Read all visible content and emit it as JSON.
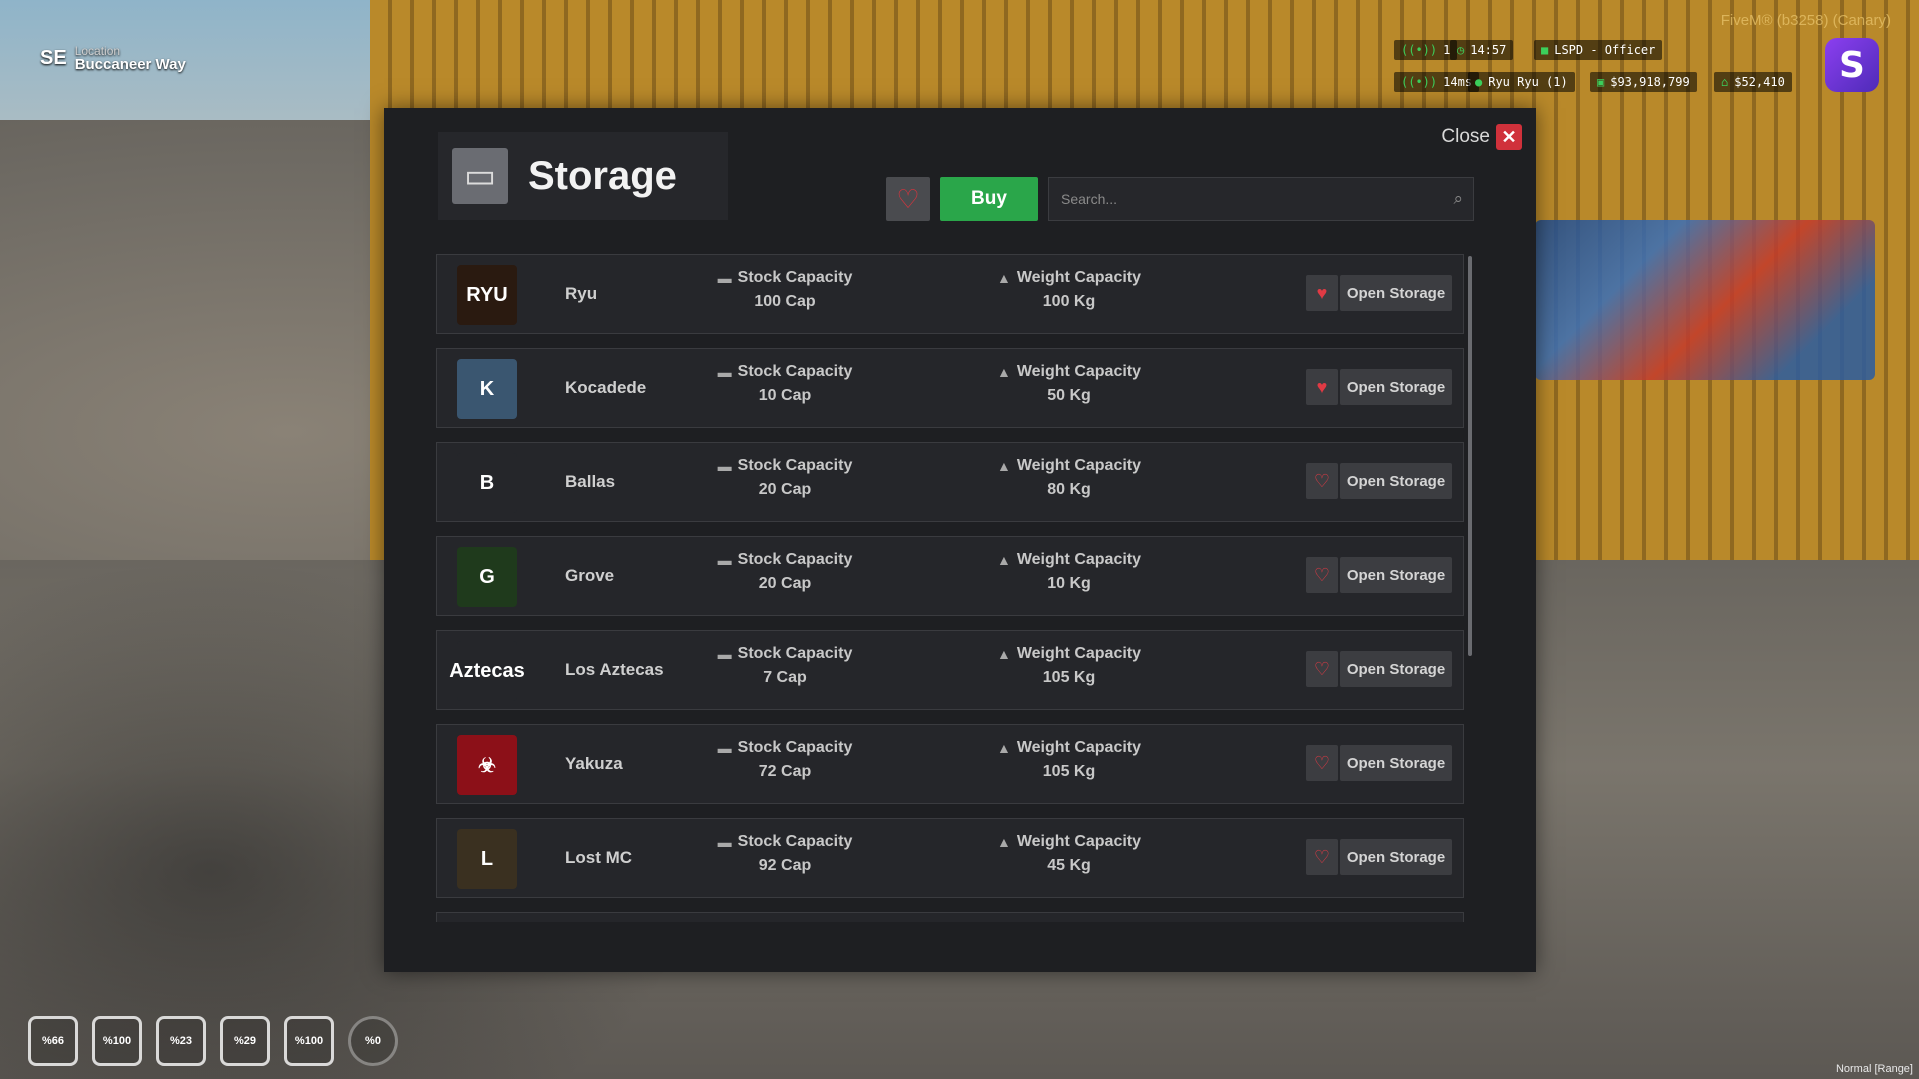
{
  "location": {
    "direction": "SE",
    "label": "Location",
    "street": "Buccaneer Way"
  },
  "client": {
    "version_label": "FiveM® (b3258) (Canary)"
  },
  "hud": {
    "players": "1",
    "time": "14:57",
    "job": "LSPD - Officer",
    "ping": "14ms",
    "player_name": "Ryu Ryu (1)",
    "cash": "$93,918,799",
    "bank": "$52,410"
  },
  "storage": {
    "title": "Storage",
    "close_label": "Close",
    "buy_label": "Buy",
    "search_placeholder": "Search...",
    "stock_label": "Stock Capacity",
    "weight_label": "Weight Capacity",
    "open_label": "Open Storage",
    "items": [
      {
        "name": "Ryu",
        "logo_text": "RYU",
        "logo_color": "#2a1a10",
        "stock": "100 Cap",
        "weight": "100 Kg",
        "favorite": true
      },
      {
        "name": "Kocadede",
        "logo_text": "K",
        "logo_color": "#3a5670",
        "stock": "10 Cap",
        "weight": "50 Kg",
        "favorite": true
      },
      {
        "name": "Ballas",
        "logo_text": "B",
        "logo_color": "#25262a",
        "stock": "20 Cap",
        "weight": "80 Kg",
        "favorite": false
      },
      {
        "name": "Grove",
        "logo_text": "G",
        "logo_color": "#1f3a1c",
        "stock": "20 Cap",
        "weight": "10 Kg",
        "favorite": false
      },
      {
        "name": "Los Aztecas",
        "logo_text": "Aztecas",
        "logo_color": "#25262a",
        "stock": "7 Cap",
        "weight": "105 Kg",
        "favorite": false
      },
      {
        "name": "Yakuza",
        "logo_text": "☣",
        "logo_color": "#8c1018",
        "stock": "72 Cap",
        "weight": "105 Kg",
        "favorite": false
      },
      {
        "name": "Lost MC",
        "logo_text": "L",
        "logo_color": "#3a3020",
        "stock": "92 Cap",
        "weight": "45 Kg",
        "favorite": false
      }
    ]
  },
  "status_bar": [
    {
      "value": "%66",
      "icon": "microphone-icon"
    },
    {
      "value": "%100",
      "icon": "heart-icon"
    },
    {
      "value": "%23",
      "icon": "food-icon"
    },
    {
      "value": "%29",
      "icon": "water-icon"
    },
    {
      "value": "%100",
      "icon": "stamina-icon"
    },
    {
      "value": "%0",
      "icon": "armor-icon"
    }
  ],
  "voice_mode": "Normal [Range]",
  "colors": {
    "accent_green": "#2aa64a",
    "close_red": "#d0313b",
    "fav_red": "#e03a44",
    "panel_bg": "#1e1f22"
  }
}
